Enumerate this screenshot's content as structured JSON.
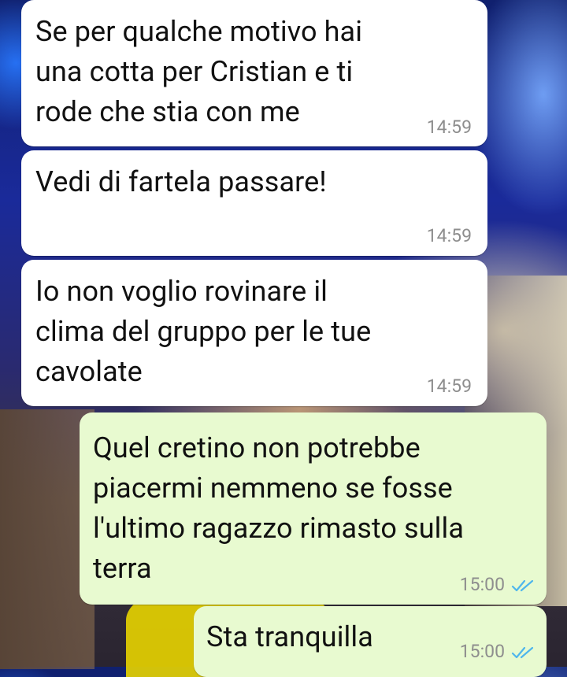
{
  "messages": [
    {
      "direction": "incoming",
      "text": "Se per qualche motivo hai\nuna cotta per Cristian e ti\nrode che stia con me",
      "time": "14:59"
    },
    {
      "direction": "incoming",
      "text": "Vedi di fartela passare!",
      "time": "14:59"
    },
    {
      "direction": "incoming",
      "text": "Io non voglio rovinare il\nclima del gruppo per le tue\ncavolate",
      "time": "14:59"
    },
    {
      "direction": "outgoing",
      "text": "Quel cretino non potrebbe\npiacermi nemmeno se fosse\nl'ultimo ragazzo rimasto sulla\nterra",
      "time": "15:00",
      "status": "read"
    },
    {
      "direction": "outgoing",
      "text": "Sta tranquilla",
      "time": "15:00",
      "status": "read"
    }
  ],
  "colors": {
    "incoming_bubble": "#ffffff",
    "outgoing_bubble": "#e8fad0",
    "read_ticks": "#4fb6ec",
    "timestamp": "#8e8e8e"
  },
  "icons": {
    "read_status": "double-check-icon"
  }
}
